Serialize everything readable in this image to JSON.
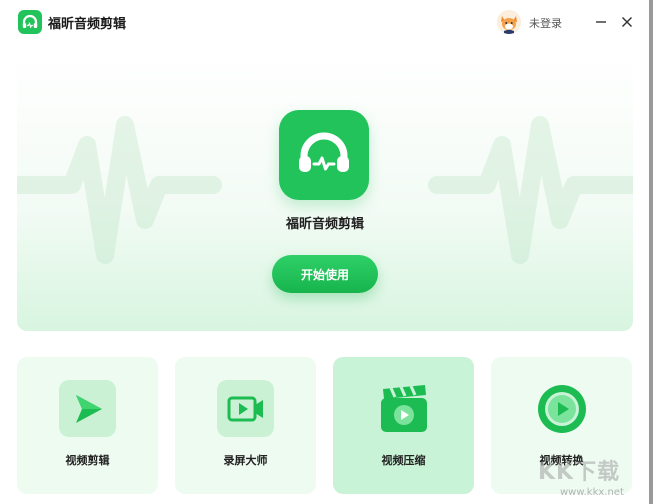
{
  "app": {
    "title": "福昕音频剪辑",
    "login_text": "未登录"
  },
  "hero": {
    "name": "福昕音频剪辑",
    "start_button": "开始使用"
  },
  "features": [
    {
      "label": "视频剪辑",
      "icon": "video-edit-icon"
    },
    {
      "label": "录屏大师",
      "icon": "screen-record-icon"
    },
    {
      "label": "视频压缩",
      "icon": "video-compress-icon",
      "active": true
    },
    {
      "label": "视频转换",
      "icon": "video-convert-icon"
    }
  ],
  "watermark": {
    "text": "KK下载",
    "url": "www.kkx.net"
  },
  "colors": {
    "brand_green": "#22c35a",
    "card_bg": "#eefbf1",
    "card_active_bg": "#c9f3d6"
  }
}
